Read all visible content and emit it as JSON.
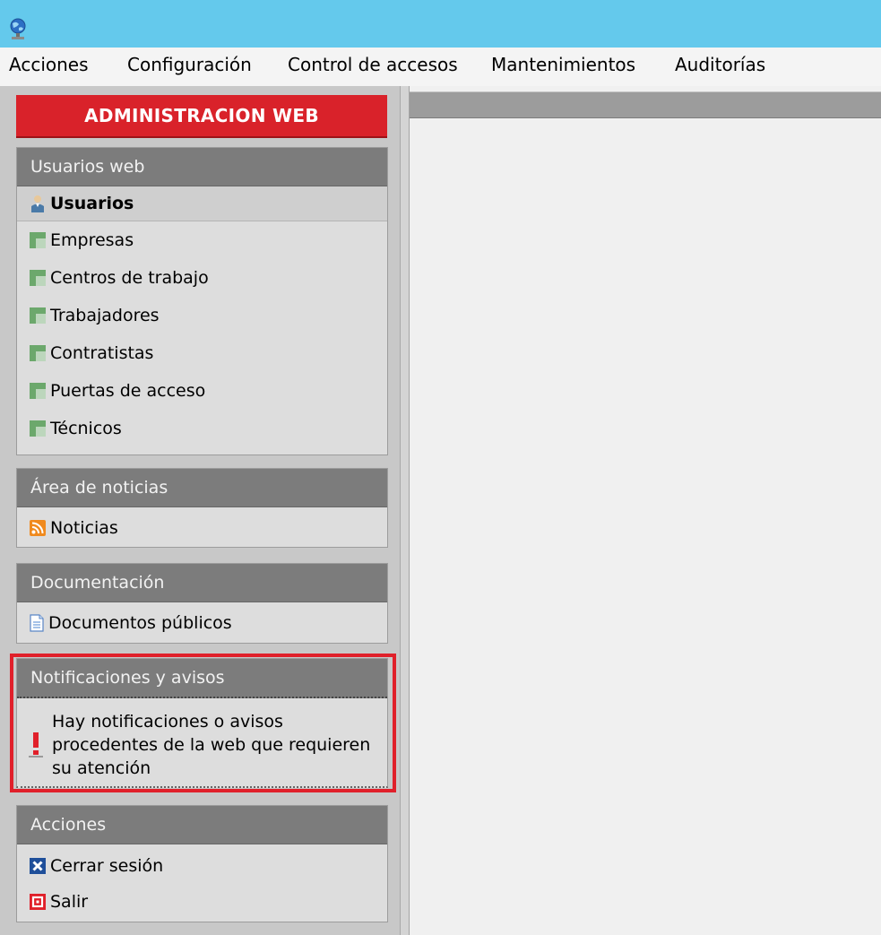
{
  "menu": [
    "Acciones",
    "Configuración",
    "Control de accesos",
    "Mantenimientos",
    "Auditorías"
  ],
  "admin_header": "ADMINISTRACION WEB",
  "usuarios_web": {
    "header": "Usuarios web",
    "items": [
      "Usuarios",
      "Empresas",
      "Centros de trabajo",
      "Trabajadores",
      "Contratistas",
      "Puertas de acceso",
      "Técnicos"
    ],
    "selected": "Usuarios"
  },
  "noticias": {
    "header": "Área de noticias",
    "items": [
      "Noticias"
    ]
  },
  "documentacion": {
    "header": "Documentación",
    "items": [
      "Documentos públicos"
    ]
  },
  "notificaciones": {
    "header": "Notificaciones y avisos",
    "message": "Hay notificaciones o avisos procedentes de la web que requieren su atención",
    "highlight_color": "#e0202a"
  },
  "acciones": {
    "header": "Acciones",
    "items": [
      "Cerrar sesión",
      "Salir"
    ]
  },
  "colors": {
    "titlebar": "#64c9ec",
    "admin_header": "#d9222a",
    "panel_header": "#7c7c7c"
  },
  "icons": {
    "app": "globe-icon",
    "usuarios": "user-icon",
    "grid_items": "grid-table-icon",
    "noticias": "rss-icon",
    "documentos": "document-icon",
    "notificacion": "exclamation-icon",
    "cerrar_sesion": "close-icon",
    "salir": "exit-icon"
  }
}
